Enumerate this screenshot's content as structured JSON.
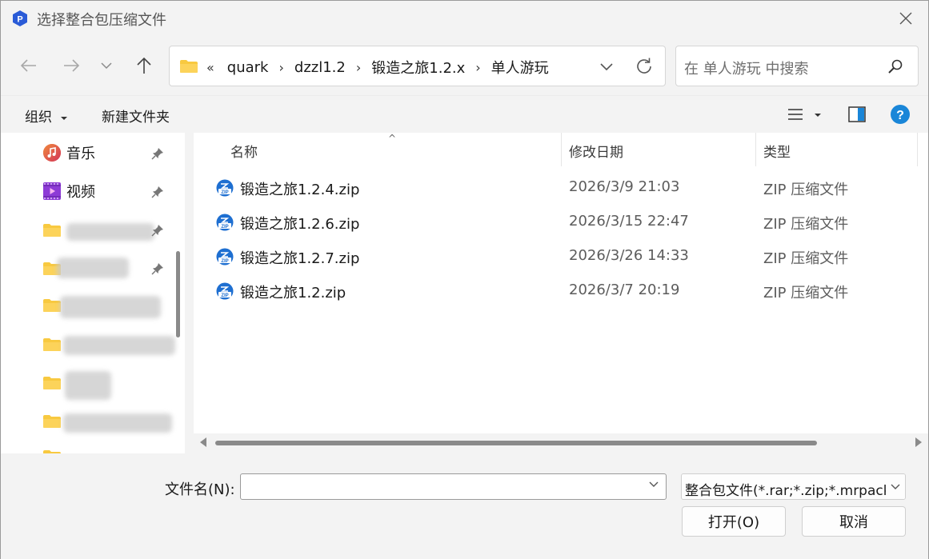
{
  "window": {
    "title": "选择整合包压缩文件",
    "app_icon_letter": "P"
  },
  "address": {
    "crumbs": [
      "quark",
      "dzzl1.2",
      "锻造之旅1.2.x",
      "单人游玩"
    ],
    "overflow": "«"
  },
  "search": {
    "placeholder": "在 单人游玩 中搜索"
  },
  "toolbar": {
    "organize_label": "组织",
    "new_folder_label": "新建文件夹"
  },
  "sidebar": {
    "items": [
      {
        "label": "音乐",
        "icon": "music-icon",
        "pinned": true
      },
      {
        "label": "视频",
        "icon": "video-icon",
        "pinned": true
      }
    ],
    "blurred_folder_count": 6
  },
  "columns": {
    "name": "名称",
    "date": "修改日期",
    "type": "类型"
  },
  "files": [
    {
      "name": "锻造之旅1.2.4.zip",
      "date": "2026/3/9 21:03",
      "type": "ZIP 压缩文件"
    },
    {
      "name": "锻造之旅1.2.6.zip",
      "date": "2026/3/15 22:47",
      "type": "ZIP 压缩文件"
    },
    {
      "name": "锻造之旅1.2.7.zip",
      "date": "2026/3/26 14:33",
      "type": "ZIP 压缩文件"
    },
    {
      "name": "锻造之旅1.2.zip",
      "date": "2026/3/7 20:19",
      "type": "ZIP 压缩文件"
    }
  ],
  "footer": {
    "filename_label": "文件名(N):",
    "filename_value": "",
    "filter_value": "整合包文件(*.rar;*.zip;*.mrpack)",
    "open_label": "打开(O)",
    "cancel_label": "取消"
  },
  "colors": {
    "accent": "#0078d4",
    "folder": "#f8c940",
    "help": "#1a86d8"
  }
}
